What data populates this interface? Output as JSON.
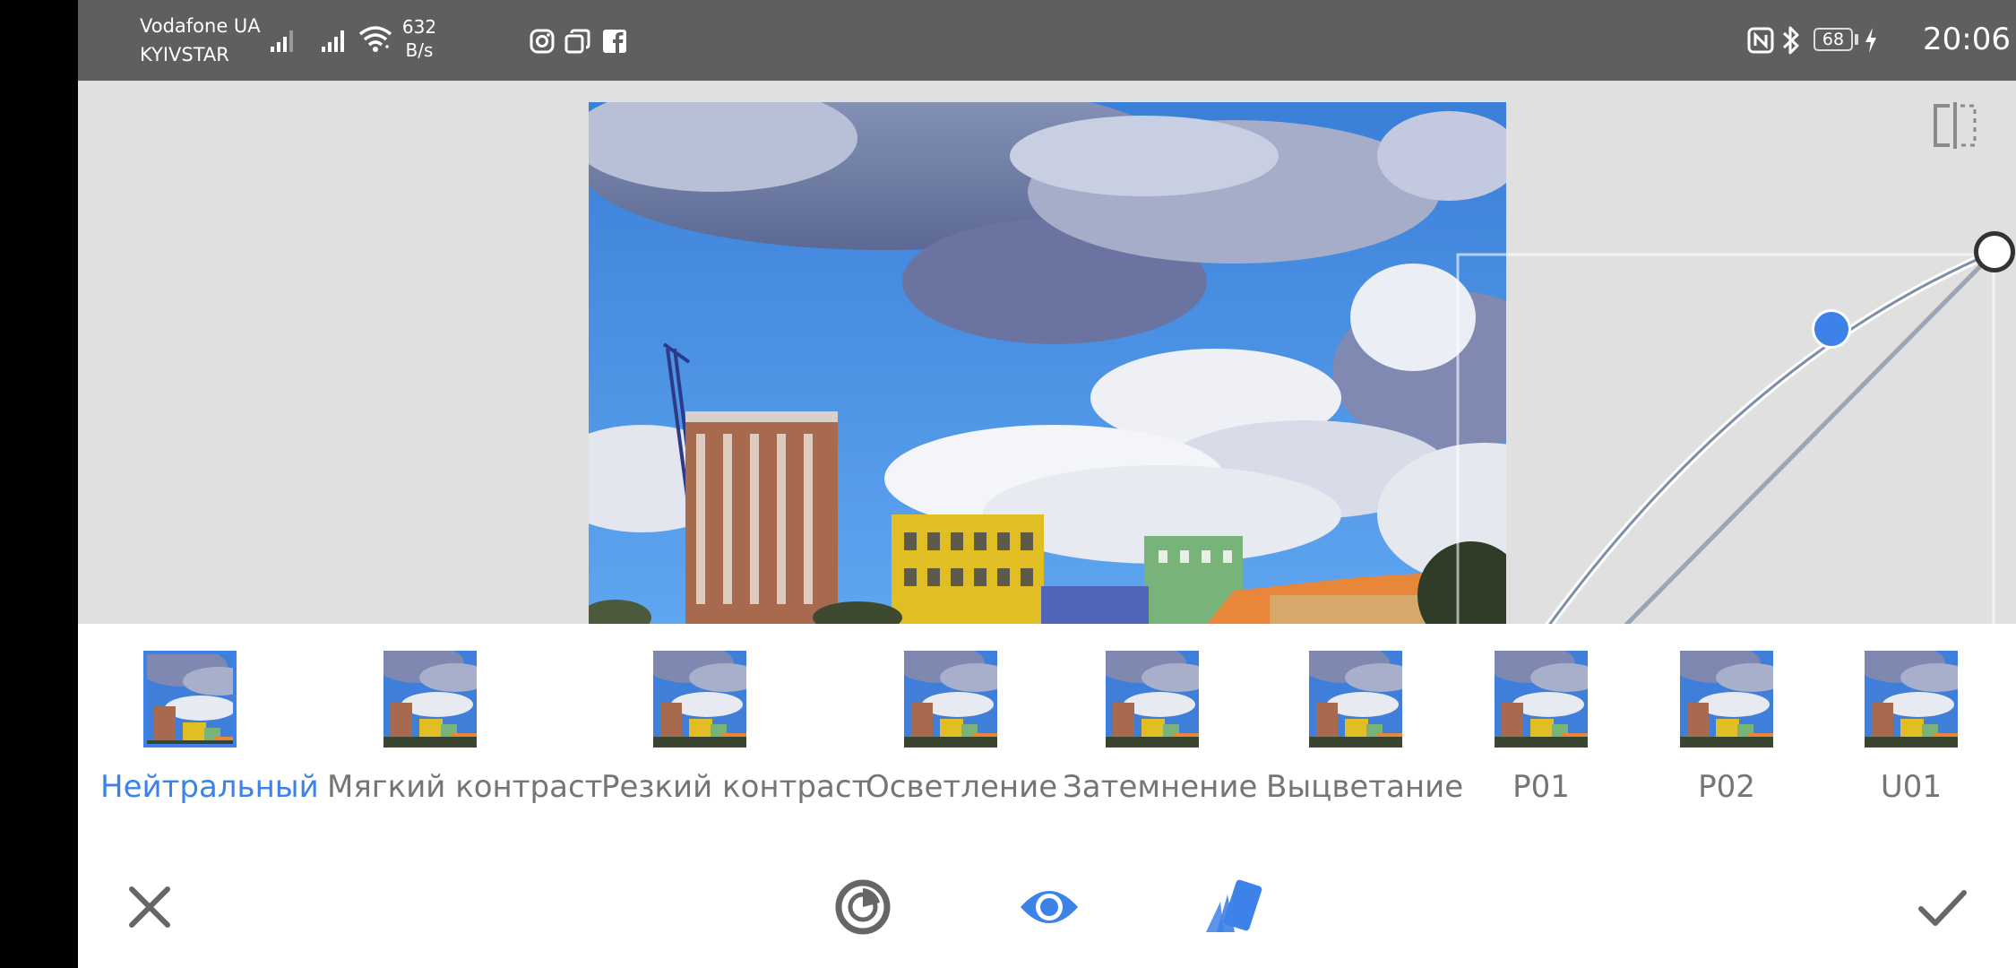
{
  "status_bar": {
    "carrier_1": "Vodafone UA",
    "carrier_2": "KYIVSTAR",
    "net_speed_value": "632",
    "net_speed_unit": "B/s",
    "battery": "68",
    "time": "20:06"
  },
  "presets": [
    {
      "label": "Нейтральный",
      "selected": true
    },
    {
      "label": "Мягкий контраст",
      "selected": false
    },
    {
      "label": "Резкий контраст",
      "selected": false
    },
    {
      "label": "Осветление",
      "selected": false
    },
    {
      "label": "Затемнение",
      "selected": false
    },
    {
      "label": "Выцветание",
      "selected": false
    },
    {
      "label": "P01",
      "selected": false
    },
    {
      "label": "P02",
      "selected": false
    },
    {
      "label": "U01",
      "selected": false
    }
  ],
  "toolbar": {
    "cancel": "close-icon",
    "tool_1": "auto-adjust-icon",
    "tool_2": "eye-icon",
    "tool_3": "styles-icon",
    "apply": "check-icon"
  },
  "colors": {
    "accent": "#3d82e8",
    "status_bar": "#5f5f5f",
    "editor_bg": "#e0e0e0",
    "label_gray": "#757575"
  }
}
